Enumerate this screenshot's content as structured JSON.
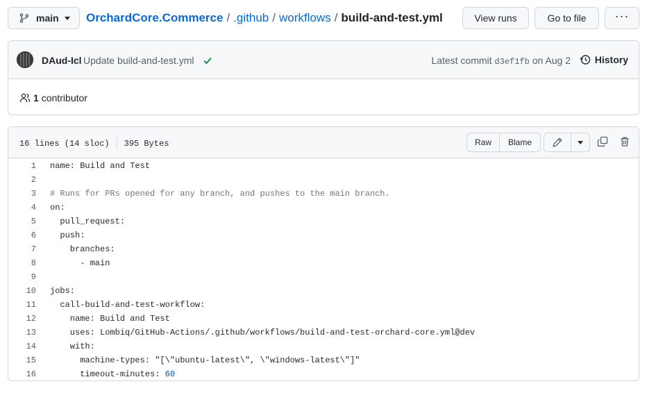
{
  "branch": {
    "label": "main",
    "icon": "git-branch-icon"
  },
  "breadcrumb": {
    "repo": "OrchardCore.Commerce",
    "sep": "/",
    "folder1": ".github",
    "folder2": "workflows",
    "file": "build-and-test.yml"
  },
  "actions": {
    "view_runs": "View runs",
    "go_to_file": "Go to file",
    "more": "···"
  },
  "commit": {
    "author": "DAud-Icl",
    "message": "Update build-and-test.yml",
    "status_icon": "check-icon",
    "status_color": "#1a7f37",
    "latest_prefix": "Latest commit",
    "sha": "d3ef1fb",
    "date_text": "on Aug 2",
    "history_label": "History"
  },
  "contributors": {
    "count": "1",
    "label": "contributor"
  },
  "file": {
    "lines_info": "16 lines (14 sloc)",
    "size": "395 Bytes",
    "raw_label": "Raw",
    "blame_label": "Blame"
  },
  "code_lines": [
    {
      "n": "1",
      "text": "name: Build and Test"
    },
    {
      "n": "2",
      "text": ""
    },
    {
      "n": "3",
      "text": "# Runs for PRs opened for any branch, and pushes to the main branch.",
      "comment": true
    },
    {
      "n": "4",
      "text": "on:"
    },
    {
      "n": "5",
      "text": "  pull_request:"
    },
    {
      "n": "6",
      "text": "  push:"
    },
    {
      "n": "7",
      "text": "    branches:"
    },
    {
      "n": "8",
      "text": "      - main"
    },
    {
      "n": "9",
      "text": ""
    },
    {
      "n": "10",
      "text": "jobs:"
    },
    {
      "n": "11",
      "text": "  call-build-and-test-workflow:"
    },
    {
      "n": "12",
      "text": "    name: Build and Test"
    },
    {
      "n": "13",
      "text": "    uses: Lombiq/GitHub-Actions/.github/workflows/build-and-test-orchard-core.yml@dev"
    },
    {
      "n": "14",
      "text": "    with:"
    },
    {
      "n": "15",
      "text": "      machine-types: \"[\\\"ubuntu-latest\\\", \\\"windows-latest\\\"]\""
    },
    {
      "n": "16",
      "text": "      timeout-minutes: ",
      "num": "60"
    }
  ]
}
